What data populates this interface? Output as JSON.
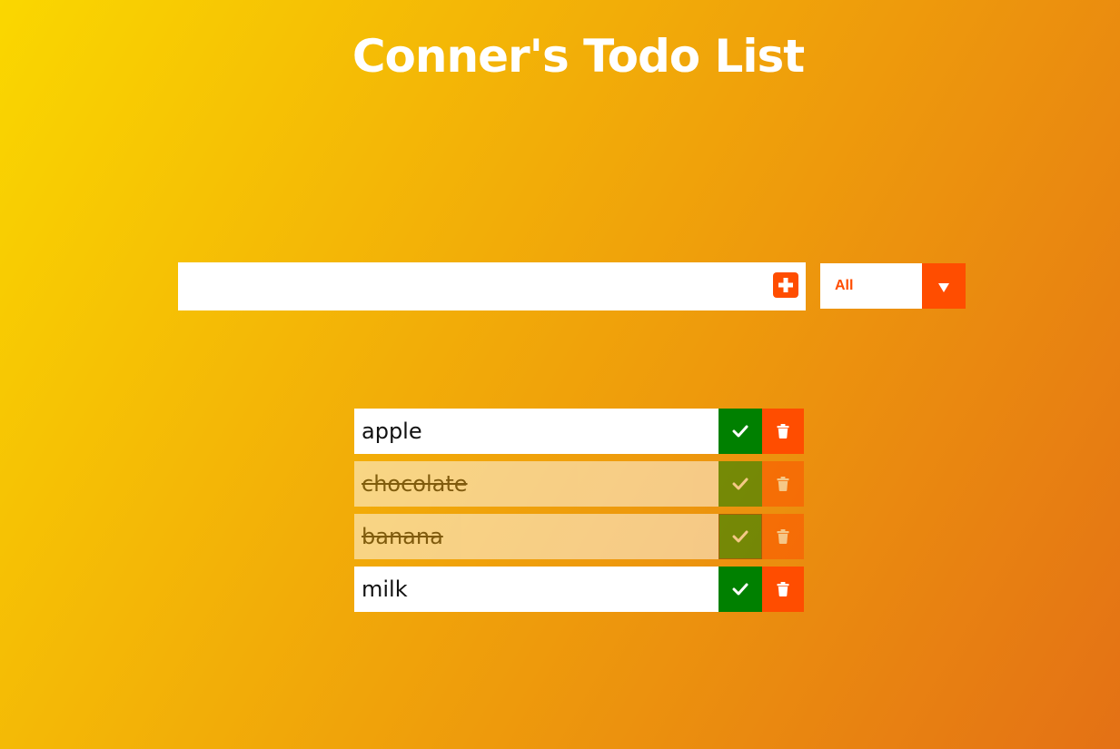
{
  "header": {
    "title": "Conner's Todo List"
  },
  "form": {
    "input_value": "",
    "input_placeholder": "",
    "add_icon": "plus-square-icon",
    "filter": {
      "selected": "All",
      "arrow_icon": "caret-down-icon"
    }
  },
  "todos": [
    {
      "text": "apple",
      "completed": false
    },
    {
      "text": "chocolate",
      "completed": true
    },
    {
      "text": "banana",
      "completed": true
    },
    {
      "text": "milk",
      "completed": false
    }
  ],
  "icons": {
    "complete": "check-icon",
    "delete": "trash-icon"
  },
  "colors": {
    "background_start": "#fad700",
    "background_end": "#e47115",
    "accent": "#ff4d00",
    "complete": "#008000",
    "text": "#111111"
  }
}
